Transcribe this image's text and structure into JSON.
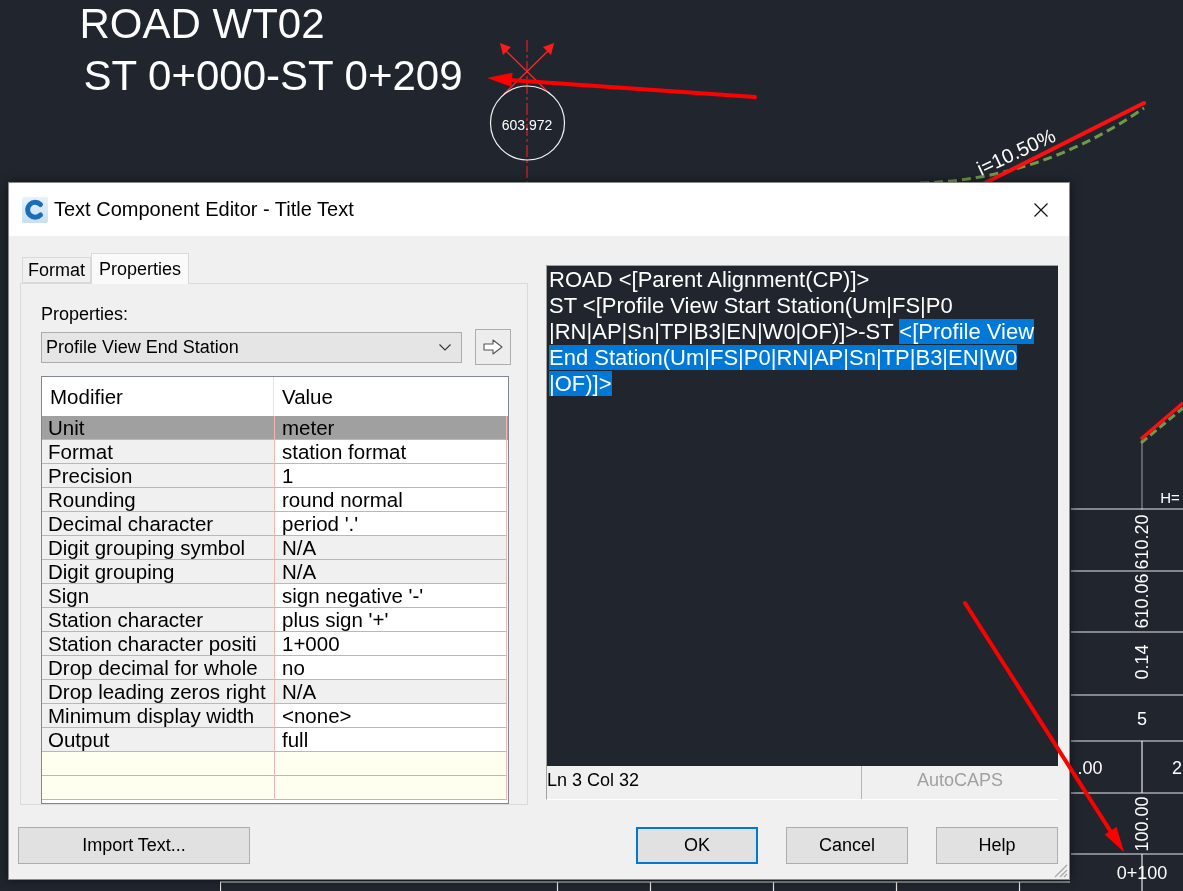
{
  "drawing": {
    "title": "ROAD WT02",
    "subtitle": "ST 0+000-ST 0+209",
    "elevation": "603.972",
    "grade": "i=10.50%",
    "band_title": "H=",
    "band_values": [
      {
        "text": "610.20",
        "kind": "vertical"
      },
      {
        "text": "610.06",
        "kind": "vertical"
      },
      {
        "text": "0.14",
        "kind": "vertical"
      },
      {
        "text": "5",
        "kind": "horizontal"
      },
      {
        "text": ".00",
        "kind": "horizontal"
      },
      {
        "text": "2",
        "kind": "horizontal"
      },
      {
        "text": "100.00",
        "kind": "vertical"
      },
      {
        "text": "0+100",
        "kind": "horizontal"
      }
    ]
  },
  "dialog": {
    "title": "Text Component Editor - Title Text",
    "tabs": [
      {
        "label": "Format",
        "selected": false
      },
      {
        "label": "Properties",
        "selected": true
      }
    ],
    "properties_label": "Properties:",
    "property_select": {
      "value": "Profile View End Station"
    },
    "table": {
      "columns": [
        "Modifier",
        "Value"
      ],
      "rows": [
        {
          "modifier": "Unit",
          "value": "meter",
          "selected": true,
          "read_only": false
        },
        {
          "modifier": "Format",
          "value": "station format",
          "selected": false,
          "read_only": false
        },
        {
          "modifier": "Precision",
          "value": "1",
          "selected": false,
          "read_only": false
        },
        {
          "modifier": "Rounding",
          "value": "round normal",
          "selected": false,
          "read_only": false
        },
        {
          "modifier": "Decimal character",
          "value": "period '.'",
          "selected": false,
          "read_only": false
        },
        {
          "modifier": "Digit grouping symbol",
          "value": "N/A",
          "selected": false,
          "read_only": true
        },
        {
          "modifier": "Digit grouping",
          "value": "N/A",
          "selected": false,
          "read_only": true
        },
        {
          "modifier": "Sign",
          "value": "sign negative '-'",
          "selected": false,
          "read_only": false
        },
        {
          "modifier": "Station character",
          "value": "plus sign '+'",
          "selected": false,
          "read_only": false
        },
        {
          "modifier": "Station character positi",
          "value": "1+000",
          "selected": false,
          "read_only": false
        },
        {
          "modifier": "Drop decimal for whole",
          "value": "no",
          "selected": false,
          "read_only": false
        },
        {
          "modifier": "Drop leading zeros right",
          "value": "N/A",
          "selected": false,
          "read_only": true
        },
        {
          "modifier": "Minimum display width",
          "value": "<none>",
          "selected": false,
          "read_only": false
        },
        {
          "modifier": "Output",
          "value": "full",
          "selected": false,
          "read_only": false
        }
      ]
    },
    "editor": {
      "lines": [
        {
          "segments": [
            {
              "text": "ROAD <[Parent Alignment(CP)]>",
              "selected": false
            }
          ]
        },
        {
          "segments": [
            {
              "text": "ST <[Profile View Start Station(Um|FS|P0",
              "selected": false
            }
          ]
        },
        {
          "segments": [
            {
              "text": "|RN|AP|Sn|TP|B3|EN|W0|OF)]>-ST ",
              "selected": false
            },
            {
              "text": "<[Profile View",
              "selected": true
            }
          ]
        },
        {
          "segments": [
            {
              "text": "End Station(Um|FS|P0|RN|AP|Sn|TP|B3|EN|W0",
              "selected": true
            }
          ]
        },
        {
          "segments": [
            {
              "text": "|OF)]>",
              "selected": true
            }
          ]
        }
      ]
    },
    "status_bar": {
      "position": "Ln 3 Col 32",
      "autocaps": {
        "label": "AutoCAPS",
        "enabled": false
      }
    },
    "import_button": {
      "label": "Import Text..."
    },
    "buttons": [
      {
        "label": "OK",
        "focused": true
      },
      {
        "label": "Cancel",
        "focused": false
      },
      {
        "label": "Help",
        "focused": false
      }
    ]
  }
}
